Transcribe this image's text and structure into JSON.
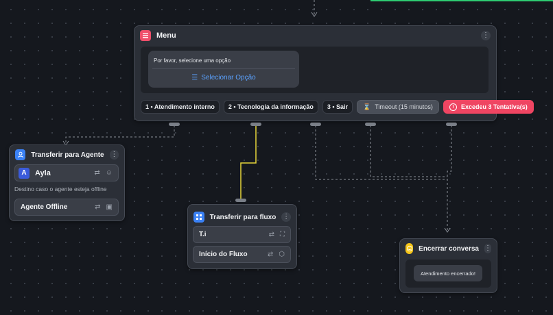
{
  "canvas": {
    "accent": "#2ecc71"
  },
  "menu_node": {
    "title": "Menu",
    "icon": "list-icon",
    "icon_color": "#ef4f6a",
    "message": "Por favor, selecione uma opção",
    "select_label": "Selecionar Opção",
    "options": [
      {
        "label": "1 • Atendimento interno"
      },
      {
        "label": "2 • Tecnologia da informação"
      },
      {
        "label": "3 • Sair"
      }
    ],
    "timeout_label": "Timeout (15 minutos)",
    "exceeded_label": "Excedeu 3 Tentativa(s)",
    "exceeded_color": "#ef4562"
  },
  "agent_node": {
    "title": "Transferir para Agente",
    "icon": "person-icon",
    "icon_color": "#3b82f6",
    "agent_name": "Ayla",
    "agent_initial": "A",
    "offline_caption": "Destino caso o agente esteja offline",
    "offline_label": "Agente Offline"
  },
  "flow_node": {
    "title": "Transferir para fluxo",
    "icon": "flow-icon",
    "icon_color": "#3b82f6",
    "items": [
      {
        "label": "T.i"
      },
      {
        "label": "Início do Fluxo"
      }
    ]
  },
  "end_node": {
    "title": "Encerrar conversa",
    "icon": "smile-icon",
    "icon_color": "#f5c518",
    "message": "Atendimento encerrado!"
  }
}
